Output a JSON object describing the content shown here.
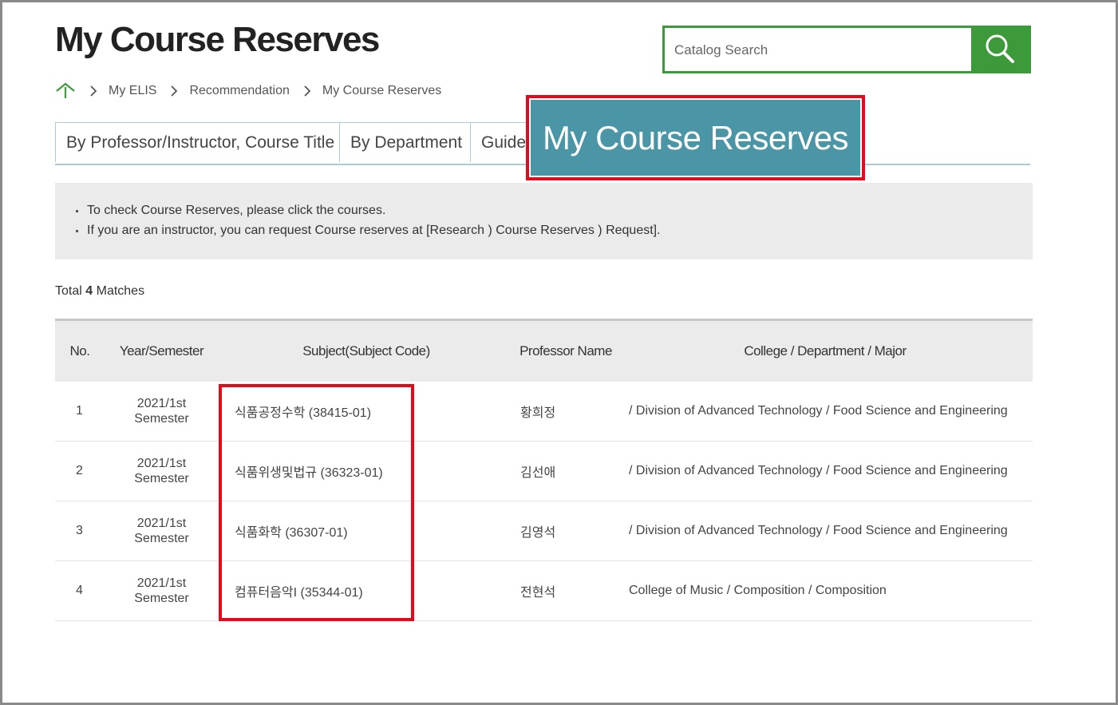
{
  "page": {
    "title": "My Course Reserves"
  },
  "search": {
    "placeholder": "Catalog Search"
  },
  "breadcrumb": {
    "items": [
      "My ELIS",
      "Recommendation",
      "My Course Reserves"
    ]
  },
  "tabs": [
    {
      "label": "By Professor/Instructor, Course Title"
    },
    {
      "label": "By Department"
    },
    {
      "label": "Guide"
    },
    {
      "label": "My Course Reserves",
      "active": true
    }
  ],
  "notice": {
    "lines": [
      "To check Course Reserves, please click the courses.",
      "If you are an instructor, you can request Course reserves at [Research ) Course Reserves ) Request]."
    ]
  },
  "results": {
    "total_prefix": "Total",
    "total_count": "4",
    "total_suffix": "Matches",
    "columns": [
      "No.",
      "Year/Semester",
      "Subject(Subject Code)",
      "Professor Name",
      "College /  Department /  Major"
    ],
    "rows": [
      {
        "no": "1",
        "year": "2021/1st",
        "semester": "Semester",
        "subject": "식품공정수학 (38415-01)",
        "professor": "황희정",
        "dept": "/ Division of Advanced Technology / Food Science and Engineering"
      },
      {
        "no": "2",
        "year": "2021/1st",
        "semester": "Semester",
        "subject": "식품위생및법규 (36323-01)",
        "professor": "김선애",
        "dept": "/ Division of Advanced Technology / Food Science and Engineering"
      },
      {
        "no": "3",
        "year": "2021/1st",
        "semester": "Semester",
        "subject": "식품화학 (36307-01)",
        "professor": "김영석",
        "dept": "/ Division of Advanced Technology / Food Science and Engineering"
      },
      {
        "no": "4",
        "year": "2021/1st",
        "semester": "Semester",
        "subject": "컴퓨터음악I (35344-01)",
        "professor": "전현석",
        "dept": "College of Music / Composition / Composition"
      }
    ]
  },
  "colors": {
    "brand_green": "#3c9a3a",
    "active_tab": "#4a95a6",
    "highlight": "#e00c1c"
  }
}
